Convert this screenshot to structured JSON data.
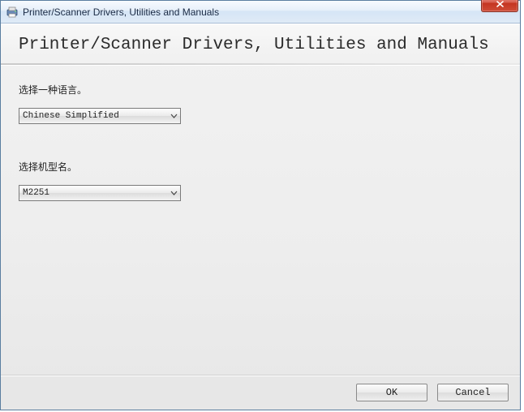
{
  "window": {
    "title": "Printer/Scanner Drivers, Utilities and Manuals"
  },
  "heading": "Printer/Scanner Drivers, Utilities and Manuals",
  "fields": {
    "language": {
      "label": "选择一种语言。",
      "value": "Chinese Simplified"
    },
    "model": {
      "label": "选择机型名。",
      "value": "M2251"
    }
  },
  "buttons": {
    "ok": "OK",
    "cancel": "Cancel"
  }
}
